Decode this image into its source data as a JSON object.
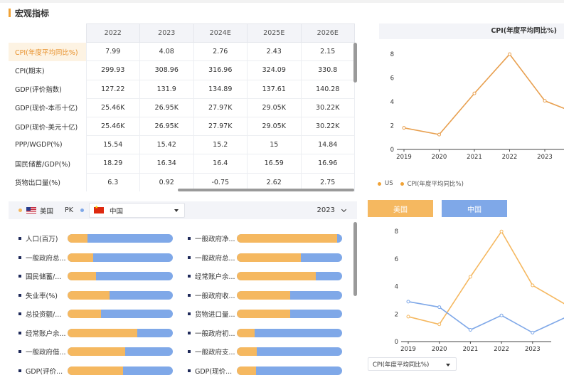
{
  "section_title": "宏观指标",
  "macro_table": {
    "columns": [
      "2022",
      "2023",
      "2024E",
      "2025E",
      "2026E"
    ],
    "rows": [
      {
        "label": "CPI(年度平均同比%)",
        "values": [
          "7.99",
          "4.08",
          "2.76",
          "2.43",
          "2.15"
        ]
      },
      {
        "label": "CPI(期末)",
        "values": [
          "299.93",
          "308.96",
          "316.96",
          "324.09",
          "330.8"
        ]
      },
      {
        "label": "GDP(评价指数)",
        "values": [
          "127.22",
          "131.9",
          "134.89",
          "137.61",
          "140.28"
        ]
      },
      {
        "label": "GDP(现价-本币十亿)",
        "values": [
          "25.46K",
          "26.95K",
          "27.97K",
          "29.05K",
          "30.22K"
        ]
      },
      {
        "label": "GDP(现价-美元十亿)",
        "values": [
          "25.46K",
          "26.95K",
          "27.97K",
          "29.05K",
          "30.22K"
        ]
      },
      {
        "label": "PPP/WGDP(%)",
        "values": [
          "15.54",
          "15.42",
          "15.2",
          "15",
          "14.84"
        ]
      },
      {
        "label": "国民储蓄/GDP(%)",
        "values": [
          "18.29",
          "16.34",
          "16.4",
          "16.59",
          "16.96"
        ]
      },
      {
        "label": "货物出口量(%)",
        "values": [
          "6.3",
          "0.92",
          "-0.75",
          "2.62",
          "2.75"
        ]
      }
    ]
  },
  "cpi_chart": {
    "title": "CPI(年度平均同比%)",
    "legend": [
      "US",
      "CPI(年度平均同比%)"
    ],
    "accent_color": "#e8a050"
  },
  "pk": {
    "left_country": "美国",
    "pk_label": "PK",
    "right_country": "中国",
    "year": "2023",
    "us_color": "#f5b860",
    "cn_color": "#7fa8e8"
  },
  "comparison": {
    "left": [
      {
        "label": "人口(百万)",
        "us_share": 0.19
      },
      {
        "label": "一般政府总...",
        "us_share": 0.24
      },
      {
        "label": "国民储蓄/...",
        "us_share": 0.27
      },
      {
        "label": "失业率(%)",
        "us_share": 0.4
      },
      {
        "label": "总投资额/...",
        "us_share": 0.32
      },
      {
        "label": "经常账户余...",
        "us_share": 0.66
      },
      {
        "label": "一般政府借...",
        "us_share": 0.55
      },
      {
        "label": "GDP(评价...",
        "us_share": 0.53
      }
    ],
    "right": [
      {
        "label": "一般政府净...",
        "us_share": 0.95
      },
      {
        "label": "一般政府总...",
        "us_share": 0.61
      },
      {
        "label": "经常账户余...",
        "us_share": 0.75
      },
      {
        "label": "一般政府收...",
        "us_share": 0.51
      },
      {
        "label": "货物进口量...",
        "us_share": 0.51
      },
      {
        "label": "一般政府初...",
        "us_share": 0.17
      },
      {
        "label": "一般政府支...",
        "us_share": 0.19
      },
      {
        "label": "GDP(现价...",
        "us_share": 0.18
      }
    ]
  },
  "buttons": {
    "us": "美国",
    "cn": "中国"
  },
  "metric_select": "CPI(年度平均同比%)",
  "chart_data": [
    {
      "type": "line",
      "title": "CPI(年度平均同比%)",
      "x": [
        "2019",
        "2020",
        "2021",
        "2022",
        "2023"
      ],
      "series": [
        {
          "name": "CPI(年度平均同比%)",
          "values": [
            1.81,
            1.25,
            4.7,
            7.99,
            4.08
          ]
        }
      ],
      "ylim": [
        0,
        8
      ],
      "yticks": [
        "0",
        "2",
        "4",
        "6",
        "8"
      ],
      "grid": false,
      "legend": "bottom-left"
    },
    {
      "type": "line",
      "x": [
        "2019",
        "2020",
        "2021",
        "2022",
        "2023"
      ],
      "series": [
        {
          "name": "美国",
          "values": [
            1.81,
            1.25,
            4.7,
            7.99,
            4.08
          ]
        },
        {
          "name": "中国",
          "values": [
            2.9,
            2.5,
            0.85,
            1.9,
            0.65
          ]
        }
      ],
      "ylim": [
        0,
        8
      ],
      "yticks": [
        "0",
        "2",
        "4",
        "6",
        "8"
      ],
      "grid": false
    }
  ]
}
